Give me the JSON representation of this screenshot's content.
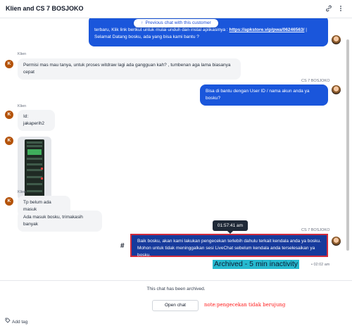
{
  "header": {
    "title": "Klien and CS 7 BOSJOKO",
    "icons": [
      "link-icon",
      "more-icon"
    ]
  },
  "chat": {
    "prev_chat_button": "Previous chat with this customer",
    "first_bubble": {
      "text_before_link": "terbaru, Klik link berikut untuk mulai unduh dan instal aplikasinya : ",
      "link": "https://apkstore.vip/pwa/06246563/",
      "text_after_link": " | Selamat Datang bosku, ada yang bisa kami bantu ?"
    },
    "messages": [
      {
        "sender": "Klien",
        "avatar": "K",
        "text": "Permisi mas mau tanya, untuk proses witdraw lagi ada gangguan kah? , tumbenan aga lama biasanya cepat"
      },
      {
        "sender": "CS 7 BOSJOKO",
        "text": "Bisa di bantu dengan User ID / nama akun anda ya bosku?"
      },
      {
        "sender": "Klien",
        "avatar": "K",
        "text": "Id: jakaperih2"
      },
      {
        "sender": "Klien",
        "avatar": "K",
        "text": "Tp belum ada masuk"
      },
      {
        "text": "Ada masuk bosku, trimakasih banyak"
      },
      {
        "sender": "CS 7 BOSJOKO",
        "lines": [
          "Baik bosku, akan kami lakukan pengecekan terlebih dahulu terkait kendala anda ya bosku.",
          "Mohon untuk tidak meninggalkan sesi LiveChat sebelum kendala anda terselesaikan ya bosku."
        ]
      }
    ],
    "tooltip_time": "01:57:41 am",
    "hash_symbol": "#",
    "archived_label": "Archived - 5 min inactivity",
    "archived_time": "• 02:02 am"
  },
  "footer": {
    "archived_text": "This chat has been archived.",
    "open_chat": "Open chat",
    "note": "note:pengecekan tidak berujung",
    "add_tag": "Add tag"
  },
  "colors": {
    "agent_bubble": "#1a56db",
    "highlight_border": "#d12c3c",
    "archived_label_bg": "#26b9cf",
    "note_text": "#ff1a1a"
  }
}
